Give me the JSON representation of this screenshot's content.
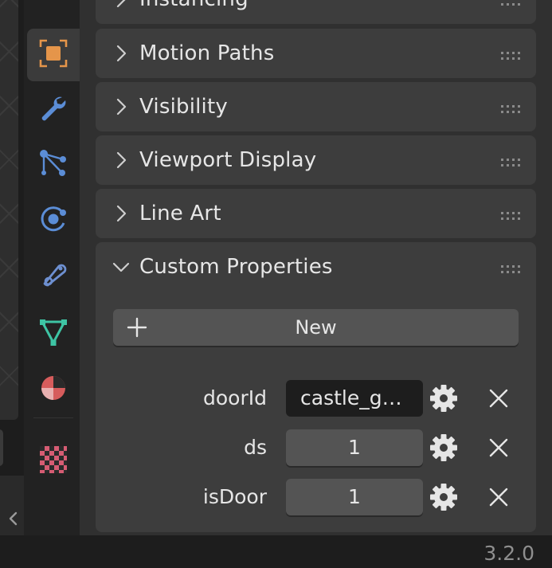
{
  "panels": {
    "instancing": {
      "title": "Instancing"
    },
    "motion_paths": {
      "title": "Motion Paths"
    },
    "visibility": {
      "title": "Visibility"
    },
    "viewport_display": {
      "title": "Viewport Display"
    },
    "line_art": {
      "title": "Line Art"
    },
    "custom_properties": {
      "title": "Custom Properties"
    }
  },
  "custom_properties": {
    "new_label": "New",
    "rows": [
      {
        "name": "doorId",
        "value": "castle_ga…"
      },
      {
        "name": "ds",
        "value": "1"
      },
      {
        "name": "isDoor",
        "value": "1"
      }
    ]
  },
  "tabs": [
    {
      "icon": "object-icon",
      "color": "#e5954a",
      "active": true
    },
    {
      "icon": "wrench-modifier-icon",
      "color": "#5b8dd6"
    },
    {
      "icon": "particles-icon",
      "color": "#5b8dd6"
    },
    {
      "icon": "physics-icon",
      "color": "#5b8dd6"
    },
    {
      "icon": "constraints-icon",
      "color": "#6d8fd0"
    },
    {
      "icon": "data-triangle-icon",
      "color": "#3ec4a4"
    },
    {
      "icon": "material-icon",
      "color": "#d65c5c"
    },
    {
      "icon": "texture-checker-icon",
      "color": "#d65c73"
    }
  ],
  "status": {
    "version": "3.2.0"
  },
  "colors": {
    "panel_bg": "#3d3d3d",
    "area_bg": "#303030",
    "button_bg": "#545454",
    "text_field_bg": "#1d1d1d",
    "text": "#e6e6e6",
    "accent_object": "#e5954a"
  }
}
